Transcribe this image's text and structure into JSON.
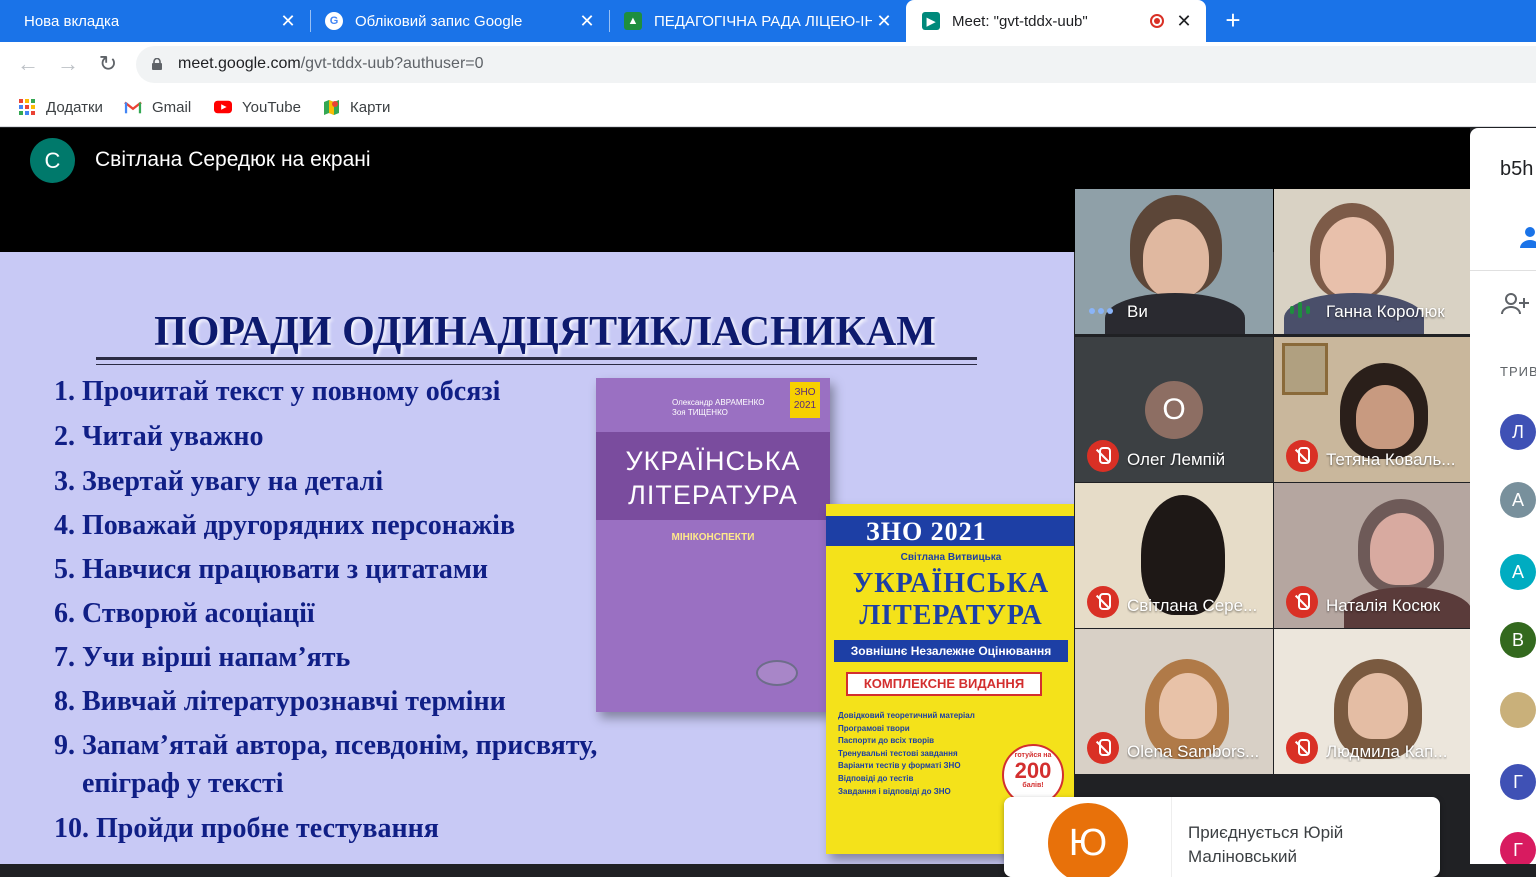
{
  "tabs": [
    {
      "title": "Нова вкладка"
    },
    {
      "title": "Обліковий запис Google"
    },
    {
      "title": "ПЕДАГОГІЧНА РАДА ЛІЦЕЮ-ІНТ"
    },
    {
      "title": "Meet: \"gvt-tddx-uub\""
    }
  ],
  "address": {
    "host": "meet.google.com",
    "path": "/gvt-tddx-uub?authuser=0"
  },
  "bookmarks": [
    {
      "label": "Додатки",
      "icon": "apps-grid-icon"
    },
    {
      "label": "Gmail",
      "icon": "gmail-icon"
    },
    {
      "label": "YouTube",
      "icon": "youtube-icon"
    },
    {
      "label": "Карти",
      "icon": "maps-icon"
    }
  ],
  "presenter": {
    "initial": "С",
    "text": "Світлана Середюк на екрані"
  },
  "slide": {
    "title": "ПОРАДИ ОДИНАДЦЯТИКЛАСНИКАМ",
    "tips": [
      "1.  Прочитай текст у повному обсязі",
      "2.  Читай уважно",
      "3. Звертай увагу на деталі",
      "4. Поважай другорядних персонажів",
      "5. Навчися працювати з цитатами",
      "6. Створюй асоціації",
      "7. Учи вірші напам’ять",
      "8. Вивчай літературознавчі терміни",
      "9. Запам’ятай автора, псевдонім, присвяту,",
      "    епіграф у тексті",
      "10. Пройди  пробне тестування"
    ],
    "book1": {
      "authors": [
        "Олександр АВРАМЕНКО",
        "Зоя ТИЩЕНКО"
      ],
      "zno": [
        "ЗНО",
        "2021"
      ],
      "title": [
        "УКРАЇНСЬКА",
        "ЛІТЕРАТУРА"
      ],
      "subtitle": "МІНІКОНСПЕКТИ"
    },
    "book2": {
      "zno": "ЗНО 2021",
      "author": "Світлана Витвицька",
      "title": [
        "УКРАЇНСЬКА",
        "ЛІТЕРАТУРА"
      ],
      "zn": "Зовнішнє Незалежне Оцінювання",
      "edition": "КОМПЛЕКСНЕ ВИДАННЯ",
      "bullets": [
        "Довідковий теоретичний матеріал",
        "Програмові твори",
        "Паспорти до всіх творів",
        "Тренувальні тестові завдання",
        "Варіанти тестів у форматі ЗНО",
        "Відповіді до тестів",
        "Завдання і відповіді до ЗНО"
      ],
      "badge_small": "готуйся на",
      "badge_big": "200",
      "badge_unit": "балів!"
    }
  },
  "participants": [
    {
      "name": "Ви",
      "muted": false
    },
    {
      "name": "Ганна Королюк",
      "muted": false
    },
    {
      "name": "Олег Лемпій",
      "muted": true,
      "initial": "О"
    },
    {
      "name": "Тетяна Коваль...",
      "muted": true
    },
    {
      "name": "Світлана Сере...",
      "muted": true
    },
    {
      "name": "Наталія Косюк",
      "muted": true
    },
    {
      "name": "Olena Sambors...",
      "muted": true
    },
    {
      "name": "Людмила Кап...",
      "muted": true
    }
  ],
  "toast": {
    "initial": "Ю",
    "message": "Приєднується Юрій Маліновський"
  },
  "sidepanel": {
    "code": "b5h",
    "section": "ТРИВ",
    "avatars": [
      {
        "initial": "Л",
        "color": "#3f51b5"
      },
      {
        "initial": "А",
        "color": "#78909c"
      },
      {
        "initial": "А",
        "color": "#00acc1"
      },
      {
        "initial": "В",
        "color": "#33691e"
      },
      {
        "initial": "",
        "color": "#c9b07a"
      },
      {
        "initial": "Г",
        "color": "#3f51b5"
      },
      {
        "initial": "Г",
        "color": "#d81b60"
      }
    ]
  },
  "colors": {
    "tabstrip": "#1a73e8",
    "slide_bg": "#c8c9f5",
    "tip_text": "#101f86",
    "mute_red": "#d93025"
  }
}
